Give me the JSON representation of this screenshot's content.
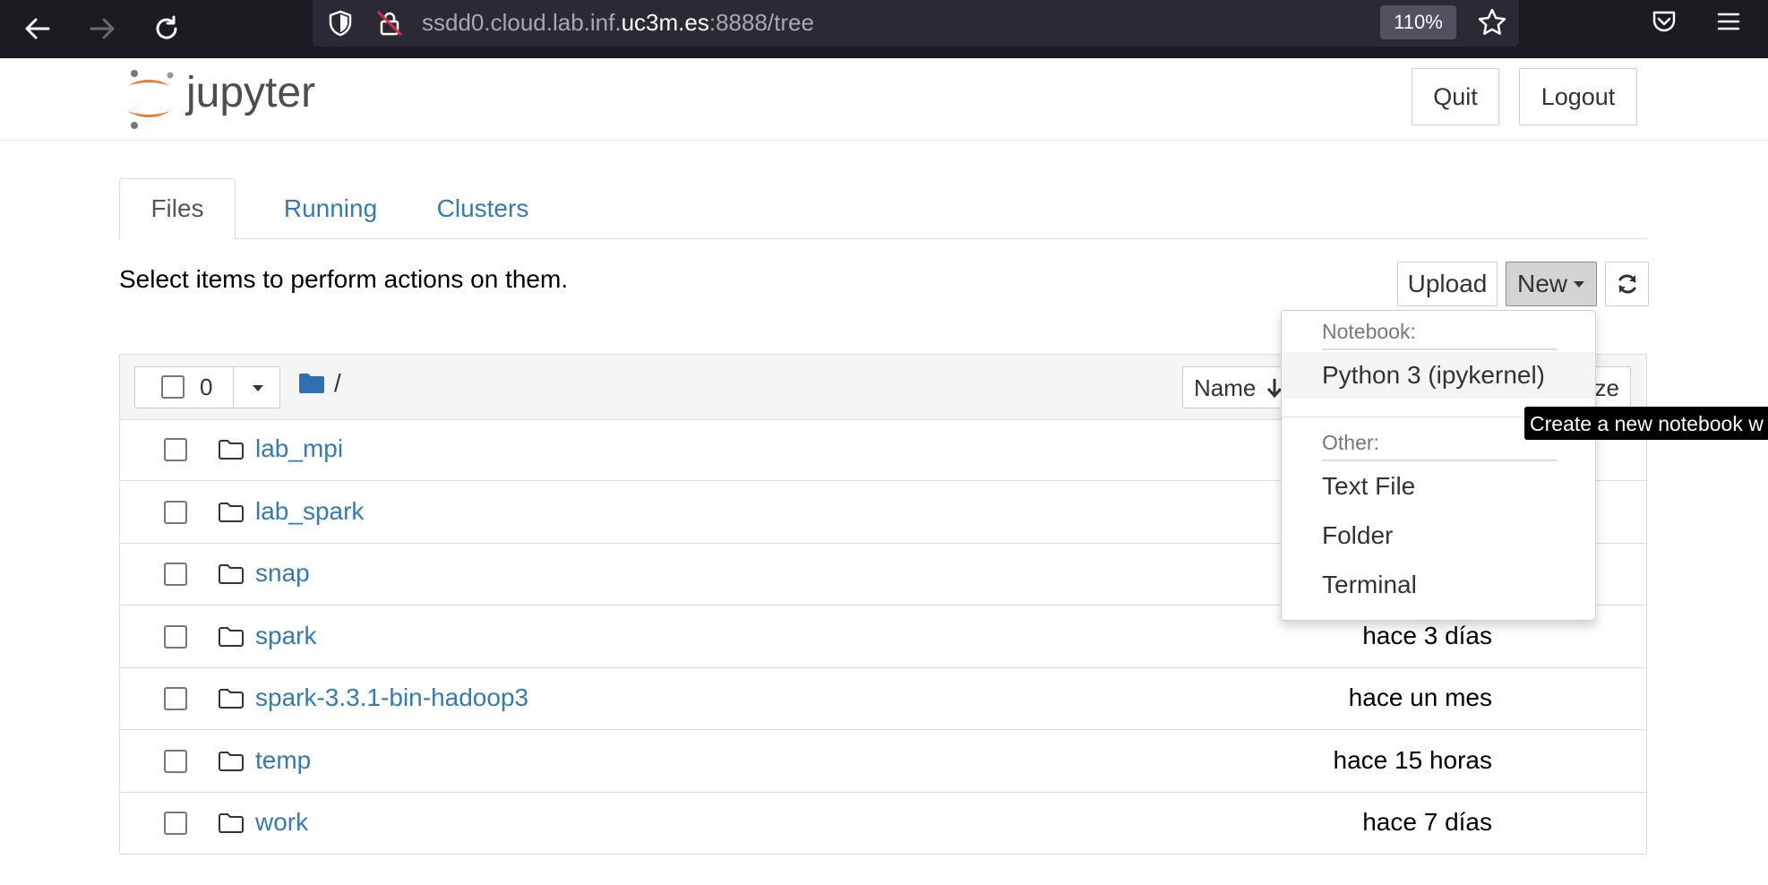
{
  "browser": {
    "url_prefix": "ssdd0.cloud.lab.inf.",
    "url_host": "uc3m.es",
    "url_suffix": ":8888/tree",
    "zoom": "110%"
  },
  "header": {
    "logo_text": "jupyter",
    "quit_label": "Quit",
    "logout_label": "Logout"
  },
  "tabs": [
    {
      "label": "Files"
    },
    {
      "label": "Running"
    },
    {
      "label": "Clusters"
    }
  ],
  "toolbar": {
    "hint": "Select items to perform actions on them.",
    "upload_label": "Upload",
    "new_label": "New"
  },
  "list": {
    "selected_count": "0",
    "breadcrumb": "/",
    "sort_name_label": "Name",
    "size_label": "ze",
    "rows": [
      {
        "name": "lab_mpi",
        "modified": ""
      },
      {
        "name": "lab_spark",
        "modified": ""
      },
      {
        "name": "snap",
        "modified": ""
      },
      {
        "name": "spark",
        "modified": "hace 3 días"
      },
      {
        "name": "spark-3.3.1-bin-hadoop3",
        "modified": "hace un mes"
      },
      {
        "name": "temp",
        "modified": "hace 15 horas"
      },
      {
        "name": "work",
        "modified": "hace 7 días"
      }
    ]
  },
  "new_menu": {
    "notebook_header": "Notebook:",
    "python_kernel": "Python 3 (ipykernel)",
    "other_header": "Other:",
    "text_file": "Text File",
    "folder": "Folder",
    "terminal": "Terminal"
  },
  "tooltip": "Create a new notebook w",
  "colors": {
    "link": "#337ab7",
    "jupyter_orange": "#f37726",
    "browser_bg": "#1c1b22",
    "folder_blue": "#2f6fb6"
  }
}
